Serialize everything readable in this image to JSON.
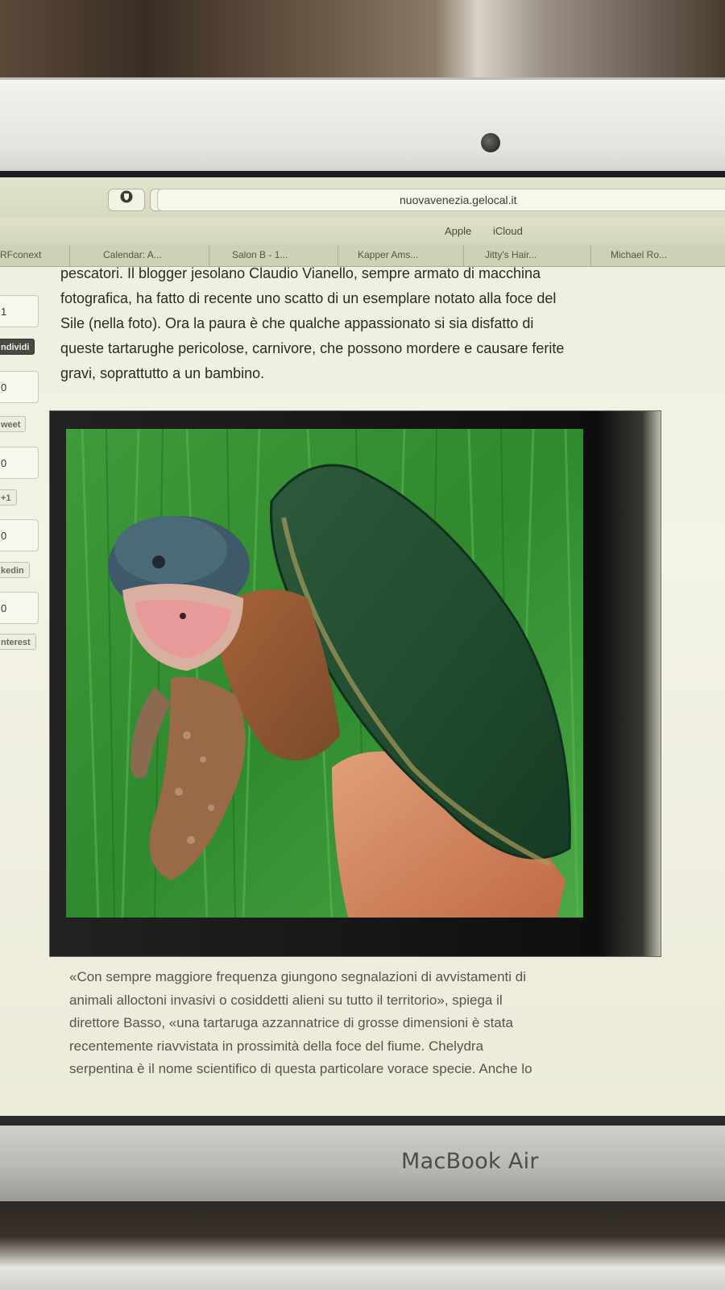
{
  "browser": {
    "url": "nuovavenezia.gelocal.it",
    "toolbar_icons": [
      "shield-icon",
      "reader-icon"
    ],
    "favorites": [
      "Apple",
      "iCloud"
    ],
    "tabs": [
      "RFconext",
      "Calendar: A...",
      "Salon B - 1...",
      "Kapper Ams...",
      "Jitty's Hair...",
      "Michael Ro..."
    ]
  },
  "social": {
    "items": [
      {
        "count": "1",
        "label": "ndividi",
        "style": "dark"
      },
      {
        "count": "0",
        "label": "weet",
        "style": "light"
      },
      {
        "count": "0",
        "label": "+1",
        "style": "light"
      },
      {
        "count": "0",
        "label": "kedin",
        "style": "light"
      },
      {
        "count": "0",
        "label": "nterest",
        "style": "light"
      }
    ]
  },
  "article": {
    "para_top": [
      "pescatori. Il blogger jesolano Claudio Vianello, sempre armato di macchina",
      "fotografica, ha fatto di recente uno scatto di un esemplare notato alla foce del",
      "Sile (nella foto). Ora la paura è che qualche appassionato si sia disfatto di",
      "queste tartarughe pericolose, carnivore, che possono mordere e causare ferite",
      "gravi, soprattutto a un bambino."
    ],
    "photo": "snapping-turtle-photo",
    "para_bottom": [
      "«Con sempre maggiore frequenza giungono segnalazioni di avvistamenti di",
      "animali alloctoni invasivi o cosiddetti alieni su tutto il territorio», spiega il",
      "direttore Basso, «una tartaruga azzannatrice di grosse dimensioni è stata",
      "recentemente riavvistata in prossimità della foce del fiume. Chelydra",
      "serpentina è il nome scientifico di questa particolare vorace specie. Anche lo"
    ]
  },
  "laptop": {
    "brand": "MacBook Air"
  },
  "colors": {
    "screen_bg": "#f1f1e2",
    "chrome_bg": "#d8dac1",
    "text": "#2b2b26"
  }
}
